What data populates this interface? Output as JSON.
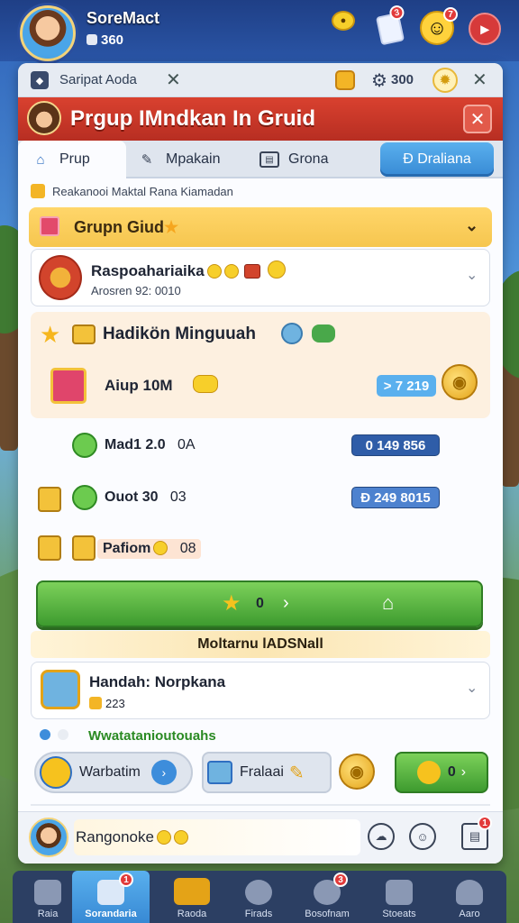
{
  "colors": {
    "title_bar": "#c9392a",
    "tab_blue": "#3789d4",
    "go_green": "#4caf3a",
    "section_gold": "#f6c64f"
  },
  "player": {
    "name": "SoreMact",
    "sub_value": "360"
  },
  "top_icons": {
    "coin_icon": "coin-icon",
    "gift_badge": "3",
    "smile_badge": "7",
    "mail_icon": "flag-icon"
  },
  "panel_header": {
    "title": "Saripat Aoda",
    "count": "300"
  },
  "title_bar": {
    "title": "Prgup IMndkan In Gruid"
  },
  "tabs": [
    {
      "label": "Prup",
      "icon": "home-icon"
    },
    {
      "label": "Mpakain",
      "icon": "tools-icon"
    },
    {
      "label": "Grona",
      "icon": "board-icon"
    },
    {
      "label": "Ð Draliana",
      "icon": ""
    }
  ],
  "subtitle": "Reakanooi Maktal Rana Kiamadan",
  "section": {
    "title": "Grupn Giud"
  },
  "card1": {
    "title": "Raspoahariaika",
    "sub": "Arosren 92: 0010"
  },
  "weekly": {
    "title": "Hadikön Minguuah",
    "item": "Aiup 10M",
    "pill": "> 7 219"
  },
  "rows": [
    {
      "label": "Mad1 2.0",
      "suffix": "0A",
      "pill": "0 149  856"
    },
    {
      "label": "Ouot 30",
      "suffix": "03",
      "pill": "Ð 249  8015"
    },
    {
      "label": "Pafiom",
      "suffix": "08"
    }
  ],
  "go_button": {
    "count": "0"
  },
  "banner": "Moltarnu lADSNall",
  "card2": {
    "title": "Handah: Norpkana",
    "sub": "223"
  },
  "green_text": "Wwatatanioutouahs",
  "action_buttons": [
    {
      "label": "Warbatim"
    },
    {
      "label": "Fralaai"
    }
  ],
  "green_button": {
    "label": "0"
  },
  "footer": {
    "field": "Rangonoke"
  },
  "bottom_nav": [
    {
      "label": "Raia",
      "badge": ""
    },
    {
      "label": "Sorandaria",
      "badge": "1"
    },
    {
      "label": "Raoda",
      "badge": ""
    },
    {
      "label": "Firads",
      "badge": ""
    },
    {
      "label": "Bosofnam",
      "badge": "3"
    },
    {
      "label": "Stoeats",
      "badge": ""
    },
    {
      "label": "Aaro",
      "badge": ""
    }
  ]
}
